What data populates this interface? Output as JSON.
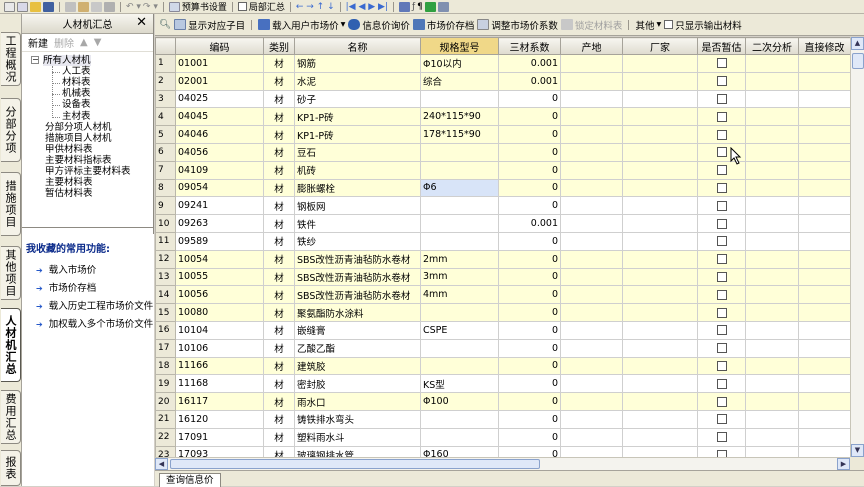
{
  "top_toolbar": {
    "preset_label": "预算书设置",
    "partial_label": "局部汇总"
  },
  "vtabs": [
    "工程概况",
    "分部分项",
    "措施项目",
    "其他项目",
    "人材机汇总",
    "费用汇总",
    "报表"
  ],
  "left_panel": {
    "title": "人材机汇总",
    "new_label": "新建",
    "delete_label": "删除",
    "tree": {
      "root": "所有人材机",
      "children": [
        "人工表",
        "材料表",
        "机械表",
        "设备表",
        "主材表"
      ],
      "siblings": [
        "分部分项人材机",
        "措施项目人材机",
        "甲供材料表",
        "主要材料指标表",
        "甲方评标主要材料表",
        "主要材料表",
        "暂估材料表"
      ]
    },
    "favorites_title": "我收藏的常用功能:",
    "favorites": [
      "载入市场价",
      "市场价存档",
      "载入历史工程市场价文件",
      "加权载入多个市场价文件"
    ]
  },
  "main_toolbar": {
    "show_subitems": "显示对应子目",
    "load_market_price": "载入用户市场价",
    "info_price_query": "信息价询价",
    "market_price_archive": "市场价存档",
    "adjust_coef": "调整市场价系数",
    "lock_table": "锁定材料表",
    "other": "其他",
    "only_output": "只显示输出材料"
  },
  "grid": {
    "columns": [
      "编码",
      "类别",
      "名称",
      "规格型号",
      "三材系数",
      "产地",
      "厂家",
      "是否暂估",
      "二次分析",
      "直接修改"
    ],
    "rows": [
      {
        "n": "1",
        "code": "01001",
        "cat": "材",
        "name": "钢筋",
        "spec": "Φ10以内",
        "coef": "0.001"
      },
      {
        "n": "2",
        "code": "02001",
        "cat": "材",
        "name": "水泥",
        "spec": "综合",
        "coef": "0.001"
      },
      {
        "n": "3",
        "code": "04025",
        "cat": "材",
        "name": "砂子",
        "spec": "",
        "coef": "0"
      },
      {
        "n": "4",
        "code": "04045",
        "cat": "材",
        "name": "KP1-P砖",
        "spec": "240*115*90",
        "coef": "0"
      },
      {
        "n": "5",
        "code": "04046",
        "cat": "材",
        "name": "KP1-P砖",
        "spec": "178*115*90",
        "coef": "0"
      },
      {
        "n": "6",
        "code": "04056",
        "cat": "材",
        "name": "豆石",
        "spec": "",
        "coef": "0"
      },
      {
        "n": "7",
        "code": "04109",
        "cat": "材",
        "name": "机砖",
        "spec": "",
        "coef": "0"
      },
      {
        "n": "8",
        "code": "09054",
        "cat": "材",
        "name": "膨胀螺栓",
        "spec": "Φ6",
        "coef": "0"
      },
      {
        "n": "9",
        "code": "09241",
        "cat": "材",
        "name": "钢板网",
        "spec": "",
        "coef": "0"
      },
      {
        "n": "10",
        "code": "09263",
        "cat": "材",
        "name": "铁件",
        "spec": "",
        "coef": "0.001"
      },
      {
        "n": "11",
        "code": "09589",
        "cat": "材",
        "name": "铁纱",
        "spec": "",
        "coef": "0"
      },
      {
        "n": "12",
        "code": "10054",
        "cat": "材",
        "name": "SBS改性沥青油毡防水卷材",
        "spec": "2mm",
        "coef": "0"
      },
      {
        "n": "13",
        "code": "10055",
        "cat": "材",
        "name": "SBS改性沥青油毡防水卷材",
        "spec": "3mm",
        "coef": "0"
      },
      {
        "n": "14",
        "code": "10056",
        "cat": "材",
        "name": "SBS改性沥青油毡防水卷材",
        "spec": "4mm",
        "coef": "0"
      },
      {
        "n": "15",
        "code": "10080",
        "cat": "材",
        "name": "聚氨酯防水涂料",
        "spec": "",
        "coef": "0"
      },
      {
        "n": "16",
        "code": "10104",
        "cat": "材",
        "name": "嵌缝膏",
        "spec": "CSPE",
        "coef": "0"
      },
      {
        "n": "17",
        "code": "10106",
        "cat": "材",
        "name": "乙酸乙酯",
        "spec": "",
        "coef": "0"
      },
      {
        "n": "18",
        "code": "11166",
        "cat": "材",
        "name": "建筑胶",
        "spec": "",
        "coef": "0"
      },
      {
        "n": "19",
        "code": "11168",
        "cat": "材",
        "name": "密封胶",
        "spec": "KS型",
        "coef": "0"
      },
      {
        "n": "20",
        "code": "16117",
        "cat": "材",
        "name": "雨水口",
        "spec": "Φ100",
        "coef": "0"
      },
      {
        "n": "21",
        "code": "16120",
        "cat": "材",
        "name": "铸铁排水弯头",
        "spec": "",
        "coef": "0"
      },
      {
        "n": "22",
        "code": "17091",
        "cat": "材",
        "name": "塑料雨水斗",
        "spec": "",
        "coef": "0"
      },
      {
        "n": "23",
        "code": "17093",
        "cat": "材",
        "name": "玻璃钢排水管",
        "spec": "Φ160",
        "coef": "0"
      }
    ]
  },
  "bottom_tab": "查询信息价",
  "colors": {
    "row_yellow": "#ffffd8",
    "header_highlight": "#f0d888",
    "selection": "#d8e4f8"
  }
}
